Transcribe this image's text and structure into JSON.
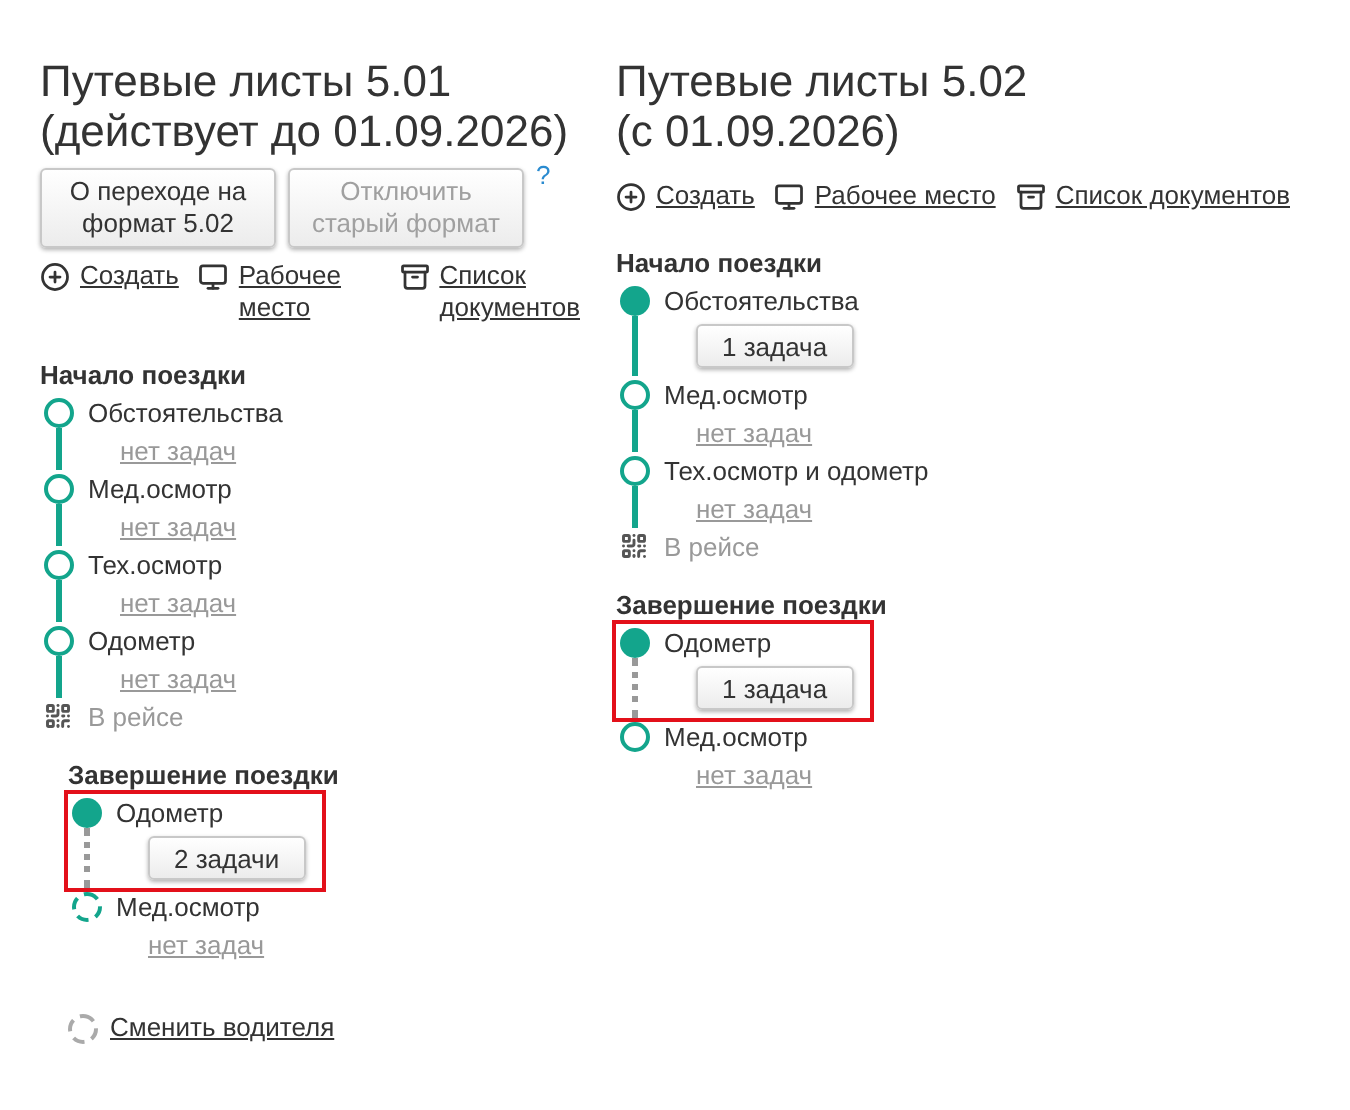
{
  "columns": [
    {
      "title_lines": [
        "Путевые листы 5.01",
        "(действует до 01.09.2026)"
      ],
      "buttons": [
        {
          "label": "О переходе на формат 5.02",
          "disabled": false
        },
        {
          "label": "Отключить старый формат",
          "disabled": true
        }
      ],
      "help": "?",
      "links": [
        {
          "label": "Создать"
        },
        {
          "label": "Рабочее место"
        },
        {
          "label": "Список документов"
        }
      ],
      "sections": [
        {
          "title": "Начало поездки",
          "steps": [
            {
              "kind": "pending",
              "label": "Обстоятельства",
              "connected": true,
              "dotted_connector": false,
              "highlighted": false,
              "task": {
                "kind": "none",
                "label": "нет задач"
              }
            },
            {
              "kind": "pending",
              "label": "Мед.осмотр",
              "connected": true,
              "dotted_connector": false,
              "highlighted": false,
              "task": {
                "kind": "none",
                "label": "нет задач"
              }
            },
            {
              "kind": "pending",
              "label": "Тех.осмотр",
              "connected": true,
              "dotted_connector": false,
              "highlighted": false,
              "task": {
                "kind": "none",
                "label": "нет задач"
              }
            },
            {
              "kind": "pending",
              "label": "Одометр",
              "connected": true,
              "dotted_connector": false,
              "highlighted": false,
              "task": {
                "kind": "none",
                "label": "нет задач"
              }
            },
            {
              "kind": "trip",
              "label": "В рейсе",
              "connected": false,
              "highlighted": false
            }
          ]
        },
        {
          "title": "Завершение поездки",
          "steps": [
            {
              "kind": "done",
              "label": "Одометр",
              "connected": true,
              "dotted_connector": true,
              "highlighted": true,
              "task": {
                "kind": "button",
                "label": "2 задачи"
              }
            },
            {
              "kind": "planned",
              "label": "Мед.осмотр",
              "connected": false,
              "highlighted": false,
              "task": {
                "kind": "none",
                "label": "нет задач"
              }
            }
          ]
        }
      ],
      "footer_link": {
        "label": "Сменить водителя"
      }
    },
    {
      "title_lines": [
        "Путевые листы 5.02",
        "(с 01.09.2026)"
      ],
      "links": [
        {
          "label": "Создать"
        },
        {
          "label": "Рабочее место"
        },
        {
          "label": "Список документов"
        }
      ],
      "sections": [
        {
          "title": "Начало поездки",
          "steps": [
            {
              "kind": "done",
              "label": "Обстоятельства",
              "connected": true,
              "dotted_connector": false,
              "highlighted": false,
              "task": {
                "kind": "button",
                "label": "1 задача"
              }
            },
            {
              "kind": "pending",
              "label": "Мед.осмотр",
              "connected": true,
              "dotted_connector": false,
              "highlighted": false,
              "task": {
                "kind": "none",
                "label": "нет задач"
              }
            },
            {
              "kind": "pending",
              "label": "Тех.осмотр и одометр",
              "connected": true,
              "dotted_connector": false,
              "highlighted": false,
              "task": {
                "kind": "none",
                "label": "нет задач"
              }
            },
            {
              "kind": "trip",
              "label": "В рейсе",
              "connected": false,
              "highlighted": false
            }
          ]
        },
        {
          "title": "Завершение поездки",
          "steps": [
            {
              "kind": "done",
              "label": "Одометр",
              "connected": true,
              "dotted_connector": true,
              "highlighted": true,
              "task": {
                "kind": "button",
                "label": "1 задача"
              }
            },
            {
              "kind": "pending",
              "label": "Мед.осмотр",
              "connected": false,
              "highlighted": false,
              "task": {
                "kind": "none",
                "label": "нет задач"
              }
            }
          ]
        }
      ]
    }
  ]
}
